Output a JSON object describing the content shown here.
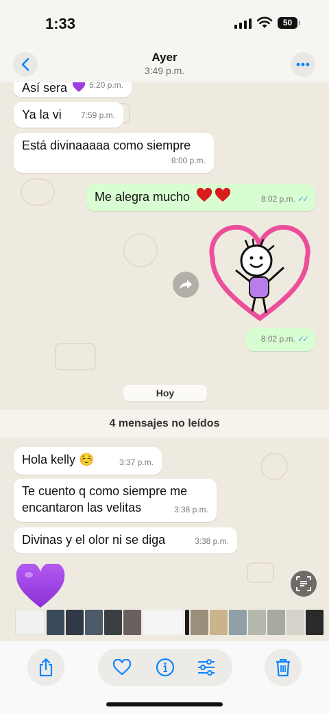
{
  "status_bar": {
    "time": "1:33",
    "battery": "50"
  },
  "header": {
    "title": "Ayer",
    "subtitle": "3:49 p.m."
  },
  "messages": [
    {
      "text": "Así sera",
      "time": "5:20 p.m."
    },
    {
      "text": "Ya la vi",
      "time": "7:59 p.m."
    },
    {
      "text": "Está divinaaaaa como siempre",
      "time": "8:00 p.m."
    },
    {
      "text": "Me alegra mucho",
      "time": "8:02 p.m."
    },
    {
      "time": "8:02 p.m."
    },
    {
      "text": "Hola kelly ☺️",
      "time": "3:37 p.m."
    },
    {
      "text": "Te cuento q como siempre me\nencantaron las velitas",
      "time": "3:38 p.m."
    },
    {
      "text": "Divinas y el olor ni se diga",
      "time": "3:38 p.m."
    }
  ],
  "day_divider": "Hoy",
  "unread_banner": "4 mensajes no leídos",
  "icons": {
    "back": "chevron-left-icon",
    "more": "ellipsis-icon",
    "forward": "forward-arrow-icon",
    "live_text": "live-text-icon",
    "share": "share-icon",
    "favorite": "heart-icon",
    "info": "info-icon",
    "adjust": "sliders-icon",
    "delete": "trash-icon"
  },
  "colors": {
    "accent": "#0a84ff",
    "outgoing_bubble": "#d9fdd3",
    "incoming_bubble": "#ffffff",
    "wallpaper": "#efeae0",
    "read_ticks": "#4fa3e0"
  }
}
